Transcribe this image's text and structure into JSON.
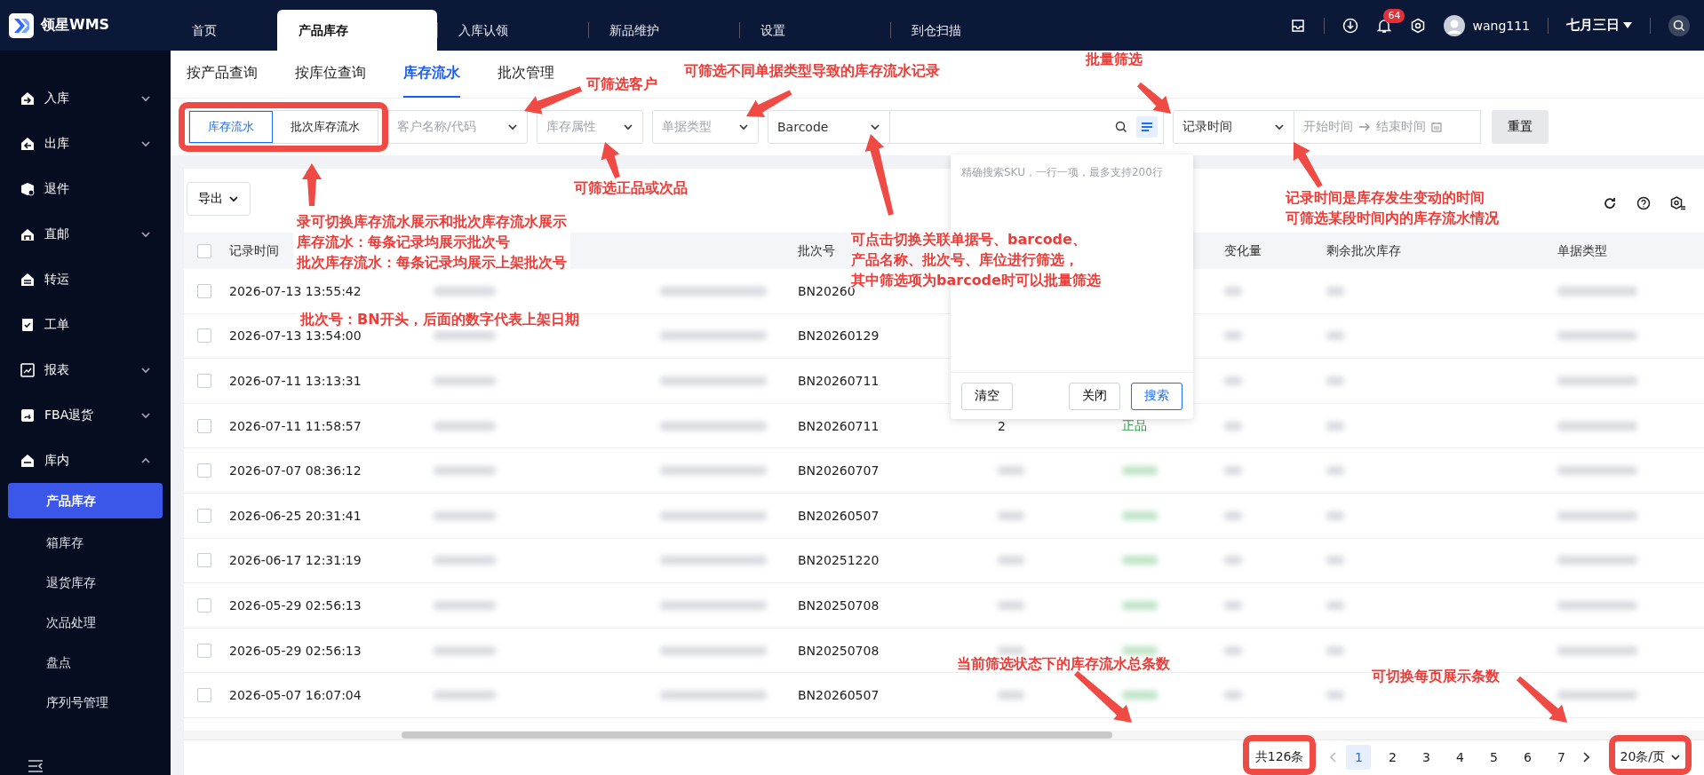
{
  "app": {
    "logo_text": "领星WMS"
  },
  "top_nav": [
    {
      "label": "首页",
      "selected": false
    },
    {
      "label": "产品库存",
      "selected": true
    },
    {
      "label": "入库认领",
      "selected": false
    },
    {
      "label": "新品维护",
      "selected": false
    },
    {
      "label": "设置",
      "selected": false
    },
    {
      "label": "到仓扫描",
      "selected": false
    }
  ],
  "header": {
    "notification_count": "64",
    "username": "wang111",
    "workspace": "七月三日"
  },
  "sidebar": {
    "items": [
      {
        "label": "入库",
        "expanded": false
      },
      {
        "label": "出库",
        "expanded": false
      },
      {
        "label": "退件"
      },
      {
        "label": "直邮",
        "expanded": false
      },
      {
        "label": "转运"
      },
      {
        "label": "工单"
      },
      {
        "label": "报表",
        "expanded": false
      },
      {
        "label": "FBA退货",
        "expanded": false
      },
      {
        "label": "库内",
        "expanded": true,
        "children": [
          {
            "label": "产品库存",
            "selected": true
          },
          {
            "label": "箱库存",
            "selected": false
          },
          {
            "label": "退货库存",
            "selected": false
          },
          {
            "label": "次品处理",
            "selected": false
          },
          {
            "label": "盘点",
            "selected": false
          },
          {
            "label": "序列号管理",
            "selected": false
          }
        ]
      }
    ]
  },
  "sub_tabs": [
    {
      "label": "按产品查询",
      "selected": false
    },
    {
      "label": "按库位查询",
      "selected": false
    },
    {
      "label": "库存流水",
      "selected": true
    },
    {
      "label": "批次管理",
      "selected": false
    }
  ],
  "filters": {
    "view_toggle": [
      {
        "label": "库存流水",
        "selected": true
      },
      {
        "label": "批次库存流水",
        "selected": false
      }
    ],
    "customer": {
      "placeholder": "客户名称/代码"
    },
    "stock_attribute": {
      "placeholder": "库存属性"
    },
    "document_type": {
      "placeholder": "单据类型"
    },
    "search_type": {
      "value": "Barcode"
    },
    "date_type": {
      "value": "记录时间"
    },
    "date_range": {
      "start_placeholder": "开始时间",
      "end_placeholder": "结束时间"
    },
    "reset_button": "重置"
  },
  "toolbar": {
    "export_button": "导出"
  },
  "table": {
    "columns": [
      {
        "label": "记录时间"
      },
      {},
      {},
      {
        "label": "批次号"
      },
      {},
      {},
      {
        "label": "变化量"
      },
      {
        "label": "剩余批次库存"
      },
      {
        "label": "单据类型"
      }
    ],
    "select_all_checked": false,
    "rows": [
      {
        "checked": false,
        "time": "2026-07-13 13:55:42",
        "batch": "BN20260"
      },
      {
        "checked": false,
        "time": "2026-07-13 13:54:00",
        "batch": "BN20260129"
      },
      {
        "checked": false,
        "time": "2026-07-11 13:13:31",
        "batch": "BN20260711"
      },
      {
        "checked": false,
        "time": "2026-07-11 11:58:57",
        "batch": "BN20260711",
        "column_5": "2",
        "column_6": "正品"
      },
      {
        "checked": false,
        "time": "2026-07-07 08:36:12",
        "batch": "BN20260707"
      },
      {
        "checked": false,
        "time": "2026-06-25 20:31:41",
        "batch": "BN20260507"
      },
      {
        "checked": false,
        "time": "2026-06-17 12:31:19",
        "batch": "BN20251220"
      },
      {
        "checked": false,
        "time": "2026-05-29 02:56:13",
        "batch": "BN20250708"
      },
      {
        "checked": false,
        "time": "2026-05-29 02:56:13",
        "batch": "BN20250708"
      },
      {
        "checked": false,
        "time": "2026-05-07 16:07:04",
        "batch": "BN20260507"
      }
    ]
  },
  "batch_popup": {
    "placeholder": "精确搜索SKU，一行一项，最多支持200行",
    "buttons": [
      {
        "label": "清空",
        "kind": "plain"
      },
      {
        "label": "关闭",
        "kind": "plain"
      },
      {
        "label": "搜索",
        "kind": "primary"
      }
    ]
  },
  "pagination": {
    "total": "共126条",
    "pages": [
      {
        "label": "1",
        "selected": true
      },
      {
        "label": "2",
        "selected": false
      },
      {
        "label": "3",
        "selected": false
      },
      {
        "label": "4",
        "selected": false
      },
      {
        "label": "5",
        "selected": false
      },
      {
        "label": "6",
        "selected": false
      },
      {
        "label": "7",
        "selected": false
      }
    ],
    "page_size": "20条/页"
  },
  "annotations": [
    {
      "lines": [
        "可筛选客户"
      ]
    },
    {
      "lines": [
        "可筛选不同单据类型导致的库存流水记录"
      ]
    },
    {
      "lines": [
        "批量筛选"
      ]
    },
    {
      "lines": [
        "可筛选正品或次品"
      ]
    },
    {
      "lines": [
        "录可切换库存流水展示和批次库存流水展示",
        "库存流水：每条记录均展示批次号",
        "批次库存流水：每条记录均展示上架批次号"
      ]
    },
    {
      "lines": [
        "批次号：BN开头，后面的数字代表上架日期"
      ]
    },
    {
      "lines": [
        "可点击切换关联单据号、barcode、",
        "产品名称、批次号、库位进行筛选，",
        "其中筛选项为barcode时可以批量筛选"
      ]
    },
    {
      "lines": [
        "记录时间是库存发生变动的时间",
        "可筛选某段时间内的库存流水情况"
      ]
    },
    {
      "lines": [
        "当前筛选状态下的库存流水总条数"
      ]
    },
    {
      "lines": [
        "可切换每页展示条数"
      ]
    }
  ]
}
